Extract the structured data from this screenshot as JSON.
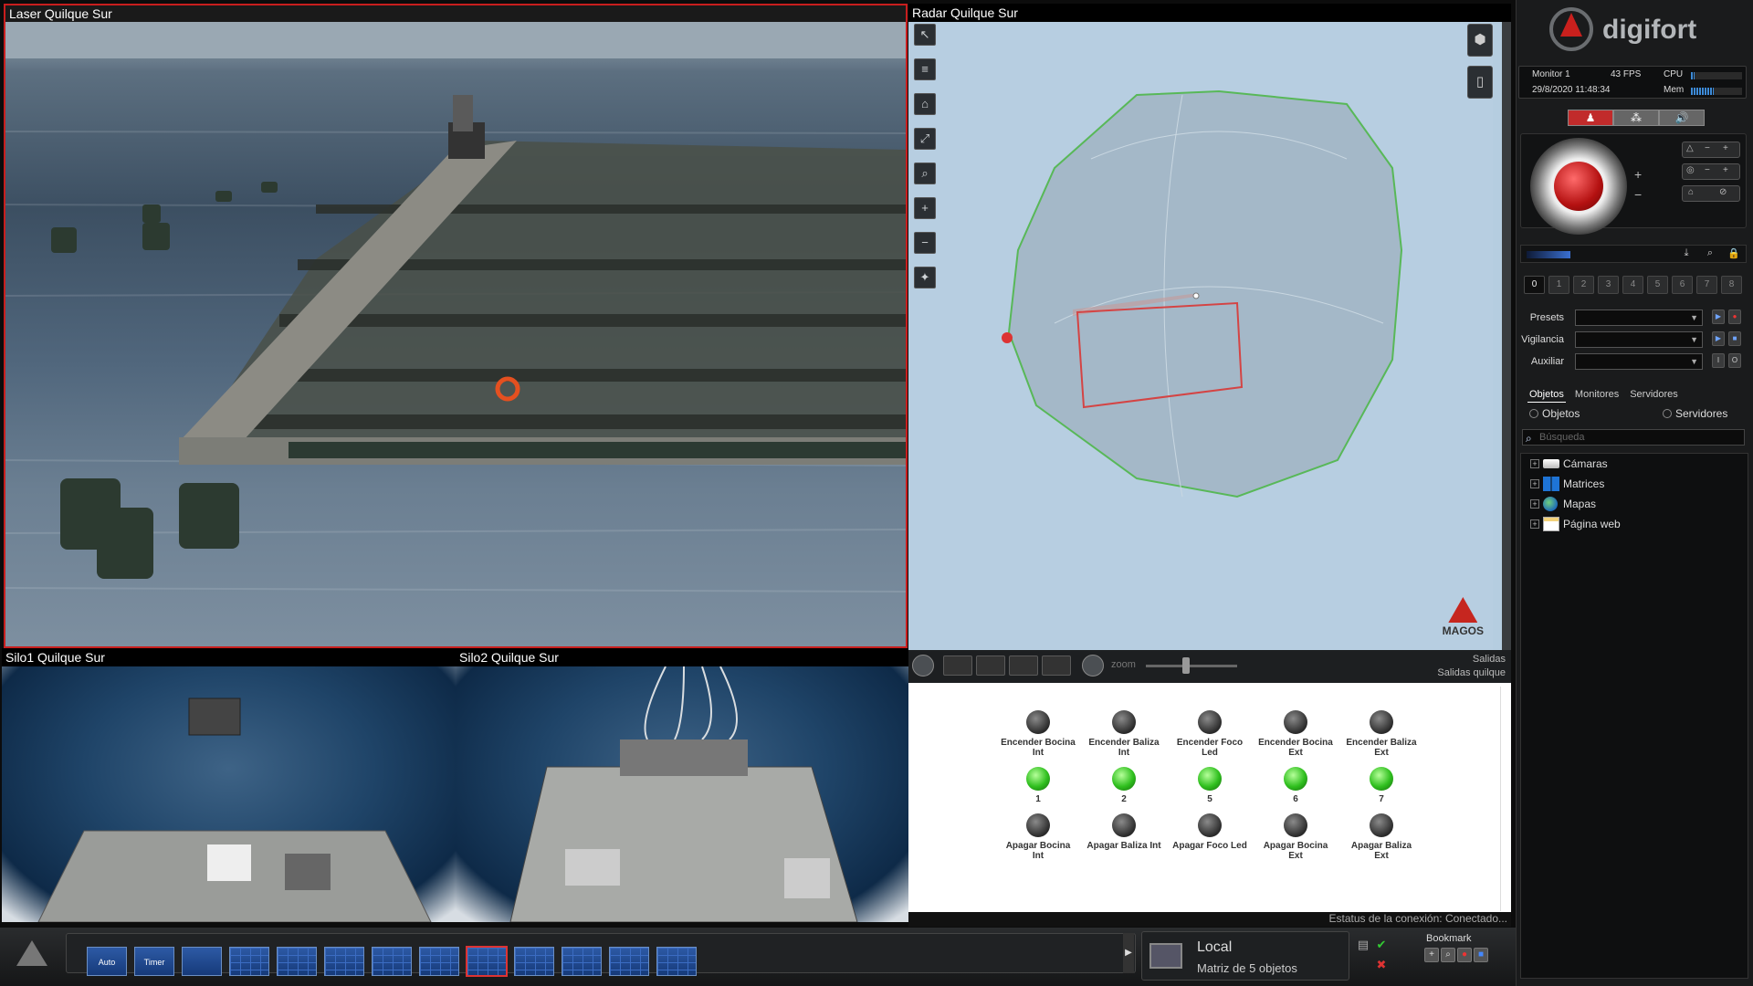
{
  "tiles": {
    "laser": {
      "title": "Laser Quilque Sur"
    },
    "radar": {
      "title": "Radar Quilque Sur",
      "brand": "MAGOS"
    },
    "silo1": {
      "title": "Silo1 Quilque Sur"
    },
    "silo2": {
      "title": "Silo2 Quilque Sur"
    }
  },
  "outputs": {
    "zoom_label": "zoom",
    "title_line1": "Salidas",
    "title_line2": "Salidas quilque",
    "rows": [
      [
        {
          "label": "Encender Bocina Int",
          "state": "off"
        },
        {
          "label": "Encender Baliza Int",
          "state": "off"
        },
        {
          "label": "Encender Foco Led",
          "state": "off"
        },
        {
          "label": "Encender Bocina Ext",
          "state": "off"
        },
        {
          "label": "Encender Baliza Ext",
          "state": "off"
        }
      ],
      [
        {
          "label": "1",
          "state": "on"
        },
        {
          "label": "2",
          "state": "on"
        },
        {
          "label": "5",
          "state": "on"
        },
        {
          "label": "6",
          "state": "on"
        },
        {
          "label": "7",
          "state": "on"
        }
      ],
      [
        {
          "label": "Apagar Bocina Int",
          "state": "off"
        },
        {
          "label": "Apagar Baliza Int",
          "state": "off"
        },
        {
          "label": "Apagar Foco Led",
          "state": "off"
        },
        {
          "label": "Apagar Bocina Ext",
          "state": "off"
        },
        {
          "label": "Apagar Baliza Ext",
          "state": "off"
        }
      ]
    ],
    "connection_status": "Estatus de la conexión: Conectado..."
  },
  "bottom_bar": {
    "layouts": [
      "Auto",
      "Timer"
    ],
    "matrix_title": "Local",
    "matrix_sub": "Matriz de 5 objetos",
    "bookmark_label": "Bookmark"
  },
  "side": {
    "brand": "digifort",
    "monitor_name": "Monitor 1",
    "fps": "43 FPS",
    "cpu_label": "CPU",
    "datetime": "29/8/2020 11:48:34",
    "mem_label": "Mem",
    "cpu_level": 0.08,
    "mem_level": 0.45,
    "presets_slider_level": 0.3,
    "numbers": [
      "0",
      "1",
      "2",
      "3",
      "4",
      "5",
      "6",
      "7",
      "8"
    ],
    "dropdowns": [
      {
        "label": "Presets",
        "value": ""
      },
      {
        "label": "Vigilancia",
        "value": ""
      },
      {
        "label": "Auxiliar",
        "value": ""
      }
    ],
    "tree_tabs": [
      "Objetos",
      "Monitores",
      "Servidores"
    ],
    "radio_objects": "Objetos",
    "radio_servers": "Servidores",
    "search_placeholder": "Búsqueda",
    "tree": [
      {
        "label": "Cámaras",
        "icon": "camera-icon"
      },
      {
        "label": "Matrices",
        "icon": "matrix-icon"
      },
      {
        "label": "Mapas",
        "icon": "globe-icon"
      },
      {
        "label": "Página web",
        "icon": "webpage-icon"
      }
    ]
  }
}
